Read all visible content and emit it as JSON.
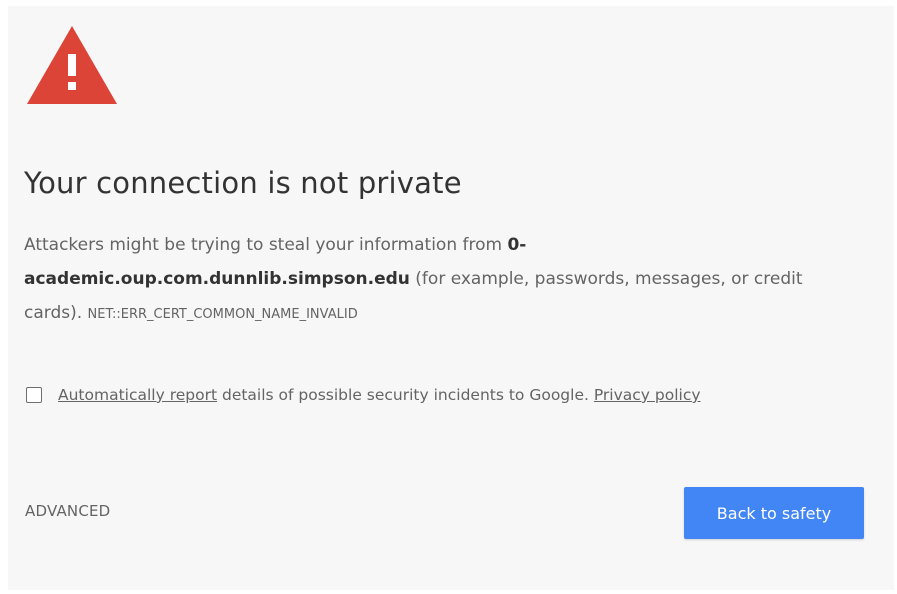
{
  "warning": {
    "icon": "warning-triangle-icon",
    "color": "#db4437"
  },
  "heading": "Your connection is not private",
  "message": {
    "prefix": "Attackers might be trying to steal your information from ",
    "domain": "0-academic.oup.com.dunnlib.simpson.edu",
    "suffix": " (for example, passwords, messages, or credit cards). ",
    "error_code": "NET::ERR_CERT_COMMON_NAME_INVALID"
  },
  "report": {
    "checked": false,
    "link_label": "Automatically report",
    "text": " details of possible security incidents to Google. ",
    "privacy_label": "Privacy policy"
  },
  "actions": {
    "advanced_label": "ADVANCED",
    "back_label": "Back to safety",
    "accent_color": "#4285f4"
  }
}
